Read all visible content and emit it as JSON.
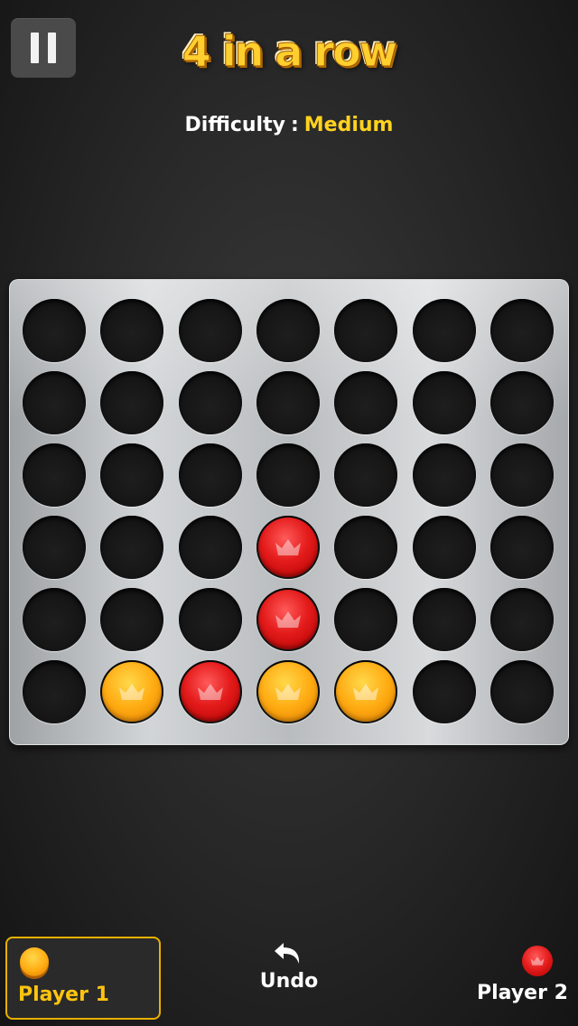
{
  "header": {
    "title": "4 in a row",
    "difficulty_label": "Difficulty",
    "difficulty_separator": ":",
    "difficulty_value": "Medium"
  },
  "board": {
    "columns": 7,
    "rows": 6,
    "grid": [
      [
        "",
        "",
        "",
        "",
        "",
        "",
        ""
      ],
      [
        "",
        "",
        "",
        "",
        "",
        "",
        ""
      ],
      [
        "",
        "",
        "",
        "",
        "",
        "",
        ""
      ],
      [
        "",
        "",
        "",
        "red",
        "",
        "",
        ""
      ],
      [
        "",
        "",
        "",
        "red",
        "",
        "",
        ""
      ],
      [
        "",
        "yellow",
        "red",
        "yellow",
        "yellow",
        "",
        ""
      ]
    ],
    "piece_colors": {
      "yellow": "#ffab12",
      "red": "#e41b1b"
    }
  },
  "footer": {
    "player1_label": "Player 1",
    "player1_color": "yellow",
    "undo_label": "Undo",
    "player2_label": "Player 2",
    "player2_color": "red",
    "active_player": "player1"
  },
  "icons": {
    "pause": "pause-icon",
    "undo": "undo-arrow-icon",
    "disc_emblem": "crown-icon"
  }
}
